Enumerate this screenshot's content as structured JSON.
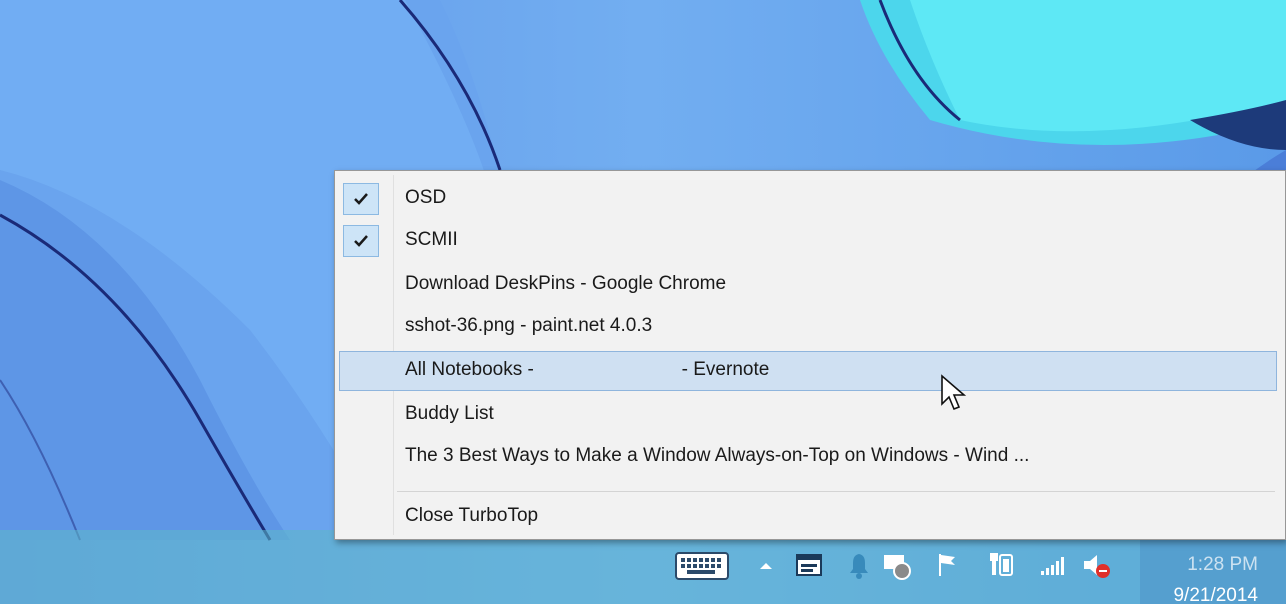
{
  "menu": {
    "items": [
      {
        "label": "OSD",
        "checked": true
      },
      {
        "label": "SCMII",
        "checked": true
      },
      {
        "label": "Download DeskPins - Google Chrome",
        "checked": false
      },
      {
        "label": "sshot-36.png - paint.net 4.0.3",
        "checked": false
      },
      {
        "label": "All Notebooks -                            - Evernote",
        "checked": false,
        "highlighted": true
      },
      {
        "label": "Buddy List",
        "checked": false
      },
      {
        "label": "The 3 Best Ways to Make a Window Always-on-Top on Windows - Wind ...",
        "checked": false
      }
    ],
    "close_label": "Close TurboTop"
  },
  "tray": {
    "icons": [
      "keyboard-icon",
      "show-hidden-icons-icon",
      "app-window-icon",
      "notification-bell-icon",
      "windows-update-icon",
      "action-center-flag-icon",
      "power-plug-icon",
      "network-signal-icon",
      "volume-muted-icon"
    ],
    "time": "1:28 PM",
    "date": "9/21/2014"
  },
  "colors": {
    "desktop": "#6ba6ee",
    "accent_highlight": "#cfe0f2",
    "taskbar": "#5fb9c8"
  }
}
